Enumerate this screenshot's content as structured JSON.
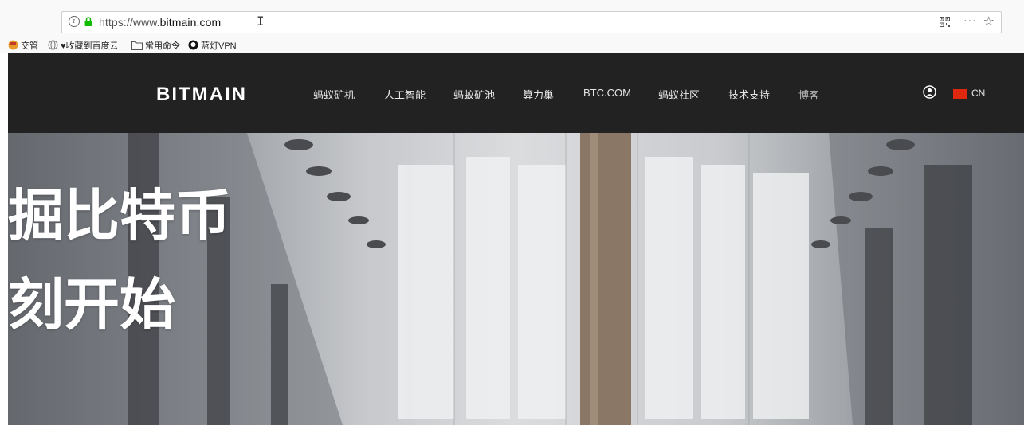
{
  "browser": {
    "url_prefix": "https://www.",
    "url_domain": "bitmain.com",
    "cursor_glyph": "I",
    "more_glyph": "···",
    "star_glyph": "☆"
  },
  "bookmarks": [
    {
      "label": "交管",
      "icon": "police-icon"
    },
    {
      "label": "♥收藏到百度云",
      "icon": "globe-icon"
    },
    {
      "label": "常用命令",
      "icon": "folder-icon"
    },
    {
      "label": "蓝灯VPN",
      "icon": "github-icon"
    }
  ],
  "header": {
    "logo": "BITMAIN",
    "nav": [
      "蚂蚁矿机",
      "人工智能",
      "蚂蚁矿池",
      "算力巢",
      "BTC.COM",
      "蚂蚁社区",
      "技术支持",
      "博客"
    ],
    "language": "CN"
  },
  "hero": {
    "line1": "掘比特币",
    "line2": "刻开始"
  },
  "colors": {
    "header_bg": "#222223",
    "flag_red": "#de2910",
    "lock_green": "#12bc00"
  }
}
